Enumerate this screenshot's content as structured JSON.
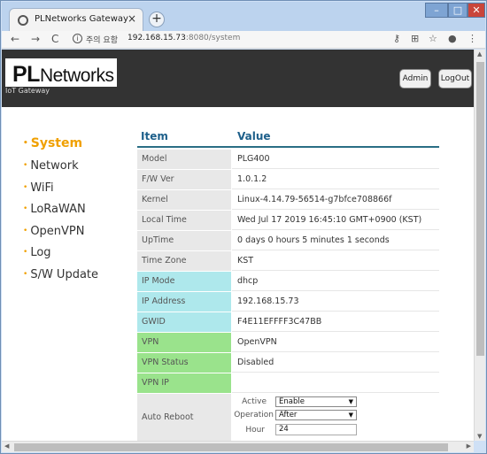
{
  "browser": {
    "tab_title": "PLNetworks Gateway",
    "tab_close": "×",
    "new_tab": "+",
    "secure_label": "주의 요함",
    "url_host": "192.168.15.73",
    "url_rest": ":8080/system",
    "win_min": "–",
    "win_max": "□",
    "win_close": "✕"
  },
  "header": {
    "logo_pl": "PL",
    "logo_rest": "Networks",
    "logo_sub": "IoT Gateway",
    "admin_label": "Admin",
    "logout_label": "LogOut"
  },
  "menu": {
    "items": [
      {
        "label": "System"
      },
      {
        "label": "Network"
      },
      {
        "label": "WiFi"
      },
      {
        "label": "LoRaWAN"
      },
      {
        "label": "OpenVPN"
      },
      {
        "label": "Log"
      },
      {
        "label": "S/W Update"
      }
    ],
    "active": "System"
  },
  "table": {
    "col_item": "Item",
    "col_value": "Value",
    "rows": [
      {
        "key": "Model",
        "value": "PLG400",
        "style": "gray"
      },
      {
        "key": "F/W Ver",
        "value": "1.0.1.2",
        "style": "gray"
      },
      {
        "key": "Kernel",
        "value": "Linux-4.14.79-56514-g7bfce708866f",
        "style": "gray"
      },
      {
        "key": "Local Time",
        "value": "Wed Jul 17 2019 16:45:10 GMT+0900 (KST)",
        "style": "gray"
      },
      {
        "key": "UpTime",
        "value": "0 days 0 hours 5 minutes 1 seconds",
        "style": "gray"
      },
      {
        "key": "Time Zone",
        "value": "KST",
        "style": "gray"
      },
      {
        "key": "IP Mode",
        "value": "dhcp",
        "style": "cyan"
      },
      {
        "key": "IP Address",
        "value": "192.168.15.73",
        "style": "cyan"
      },
      {
        "key": "GWID",
        "value": "F4E11EFFFF3C47BB",
        "style": "cyan"
      },
      {
        "key": "VPN",
        "value": "OpenVPN",
        "style": "green"
      },
      {
        "key": "VPN Status",
        "value": "Disabled",
        "style": "green"
      },
      {
        "key": "VPN IP",
        "value": "",
        "style": "green"
      }
    ],
    "auto_reboot": {
      "label": "Auto Reboot",
      "active_label": "Active",
      "active_value": "Enable",
      "operation_label": "Operation",
      "operation_value": "After",
      "hour_label": "Hour",
      "hour_value": "24"
    }
  }
}
